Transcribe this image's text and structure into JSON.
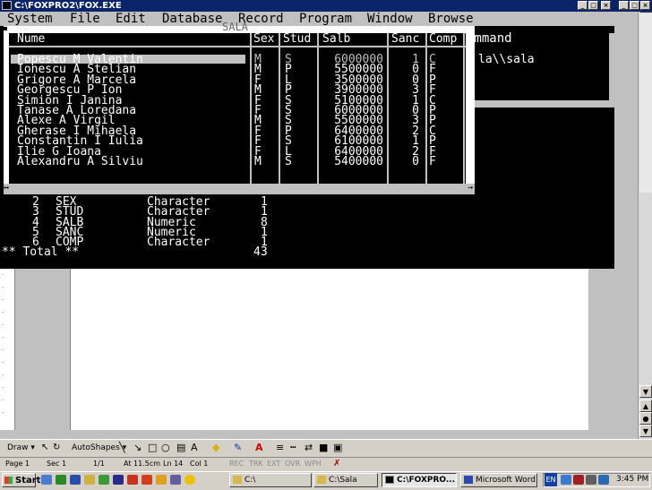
{
  "window": {
    "title": "C:\\FOXPRO2\\FOX.EXE"
  },
  "menu": {
    "items": [
      {
        "hotkey": "S",
        "label": "System"
      },
      {
        "hotkey": "F",
        "label": "File"
      },
      {
        "hotkey": "E",
        "label": "Edit"
      },
      {
        "hotkey": "D",
        "label": "Database"
      },
      {
        "hotkey": "R",
        "label": "Record"
      },
      {
        "hotkey": "P",
        "label": "Program"
      },
      {
        "hotkey": "W",
        "label": "Window"
      },
      {
        "hotkey": "B",
        "label": "Browse"
      }
    ]
  },
  "command": {
    "title": "ommand",
    "text": "la\\\\sala"
  },
  "browse": {
    "title": "SALA",
    "columns": [
      "Nume",
      "Sex",
      "Stud",
      "Salb",
      "Sanc",
      "Comp"
    ],
    "rows": [
      [
        "Popescu M Valentin",
        "M",
        "S",
        "6000000",
        "1",
        "C"
      ],
      [
        "Ionescu A Stelian",
        "M",
        "P",
        "5500000",
        "0",
        "F"
      ],
      [
        "Grigore A Marcela",
        "F",
        "L",
        "3500000",
        "0",
        "P"
      ],
      [
        "Georgescu P Ion",
        "M",
        "P",
        "3900000",
        "3",
        "F"
      ],
      [
        "Simion I Janina",
        "F",
        "S",
        "5100000",
        "1",
        "C"
      ],
      [
        "Tanase A Loredana",
        "F",
        "S",
        "6000000",
        "0",
        "P"
      ],
      [
        "Alexe A Virgil",
        "M",
        "S",
        "5500000",
        "3",
        "P"
      ],
      [
        "Gherase I Mihaela",
        "F",
        "P",
        "6400000",
        "2",
        "C"
      ],
      [
        "Constantin I Iulia",
        "F",
        "S",
        "6100000",
        "1",
        "P"
      ],
      [
        "Ilie G Ioana",
        "F",
        "L",
        "6400000",
        "2",
        "F"
      ],
      [
        "Alexandru A Silviu",
        "M",
        "S",
        "5400000",
        "0",
        "F"
      ]
    ],
    "scroll_left": "↔",
    "scroll_right": "→"
  },
  "structure": {
    "rows": [
      [
        "2",
        "SEX",
        "Character",
        "1"
      ],
      [
        "3",
        "STUD",
        "Character",
        "1"
      ],
      [
        "4",
        "SALB",
        "Numeric",
        "8"
      ],
      [
        "5",
        "SANC",
        "Numeric",
        "1"
      ],
      [
        "6",
        "COMP",
        "Character",
        "1"
      ]
    ],
    "total_label": "** Total **",
    "total_value": "43"
  },
  "drawbar": {
    "draw": "Draw ▾",
    "autoshapes": "AutoShapes ▾"
  },
  "status": {
    "page": "Page 1",
    "sec": "Sec 1",
    "pages": "1/1",
    "at": "At 11.5cm",
    "ln": "Ln 14",
    "col": "Col 1",
    "rec": "REC",
    "trk": "TRK",
    "ext": "EXT",
    "ovr": "OVR",
    "wph": "WPH"
  },
  "taskbar": {
    "start": "Start",
    "buttons": [
      {
        "label": "C:\\",
        "active": false
      },
      {
        "label": "C:\\Sala",
        "active": false
      },
      {
        "label": "C:\\FOXPRO...",
        "active": true
      },
      {
        "label": "Microsoft Word...",
        "active": false
      }
    ],
    "lang": "EN",
    "clock": "3:45 PM"
  }
}
